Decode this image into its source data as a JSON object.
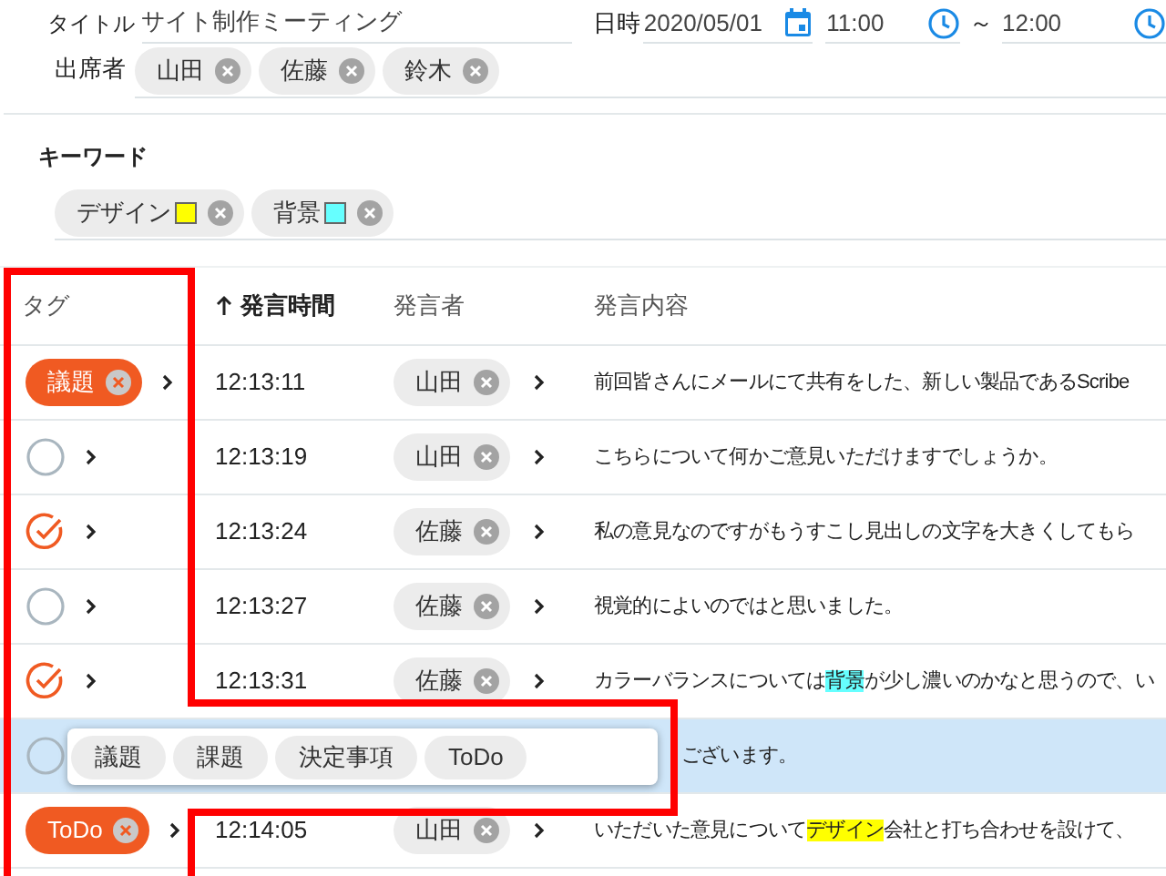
{
  "form": {
    "title_label": "タイトル",
    "title_value": "サイト制作ミーティング",
    "date_label": "日時",
    "date_value": "2020/05/01",
    "start_time": "11:00",
    "separator": "～",
    "end_time": "12:00",
    "attendees_label": "出席者",
    "attendees": [
      "山田",
      "佐藤",
      "鈴木"
    ]
  },
  "keywords": {
    "label": "キーワード",
    "items": [
      {
        "text": "デザイン",
        "color": "#ffff00"
      },
      {
        "text": "背景",
        "color": "#66ffff"
      }
    ]
  },
  "table": {
    "columns": [
      {
        "label": "タグ",
        "sorted": false
      },
      {
        "label": "発言時間",
        "sorted": true
      },
      {
        "label": "発言者",
        "sorted": false
      },
      {
        "label": "発言内容",
        "sorted": false
      }
    ],
    "rows": [
      {
        "selected": false,
        "tag": {
          "kind": "chip",
          "label": "議題"
        },
        "time": "12:13:11",
        "speaker": "山田",
        "content": [
          {
            "text": "前回皆さんにメールにて共有をした、新しい製品であるScribe"
          }
        ]
      },
      {
        "selected": false,
        "tag": {
          "kind": "check",
          "checked": false
        },
        "time": "12:13:19",
        "speaker": "山田",
        "content": [
          {
            "text": "こちらについて何かご意見いただけますでしょうか。"
          }
        ]
      },
      {
        "selected": false,
        "tag": {
          "kind": "check",
          "checked": true
        },
        "time": "12:13:24",
        "speaker": "佐藤",
        "content": [
          {
            "text": "私の意見なのですがもうすこし見出しの文字を大きくしてもら"
          }
        ]
      },
      {
        "selected": false,
        "tag": {
          "kind": "check",
          "checked": false
        },
        "time": "12:13:27",
        "speaker": "佐藤",
        "content": [
          {
            "text": "視覚的によいのではと思いました。"
          }
        ]
      },
      {
        "selected": false,
        "tag": {
          "kind": "check",
          "checked": true
        },
        "time": "12:13:31",
        "speaker": "佐藤",
        "content": [
          {
            "text": "カラーバランスについては"
          },
          {
            "text": "背景",
            "color": "#66ffff"
          },
          {
            "text": "が少し濃いのかなと思うので、い"
          }
        ]
      },
      {
        "selected": true,
        "tag": {
          "kind": "check",
          "checked": false
        },
        "menu": [
          "議題",
          "課題",
          "決定事項",
          "ToDo"
        ],
        "content": [
          {
            "text": "ございます。"
          }
        ]
      },
      {
        "selected": false,
        "tag": {
          "kind": "chip",
          "label": "ToDo"
        },
        "time": "12:14:05",
        "speaker": "山田",
        "content": [
          {
            "text": "いただいた意見について"
          },
          {
            "text": "デザイン",
            "color": "#ffff00"
          },
          {
            "text": "会社と打ち合わせを設けて、"
          }
        ]
      }
    ]
  }
}
